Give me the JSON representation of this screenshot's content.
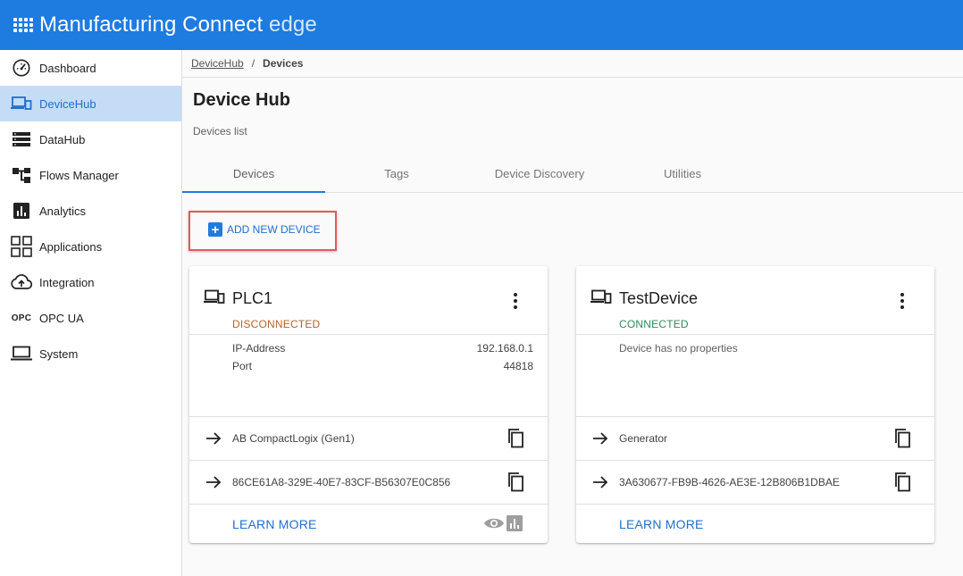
{
  "app": {
    "title_main": "Manufacturing Connect",
    "title_suffix": " edge",
    "menu_icon": "apps-grid-icon",
    "header_color": "#1e7be0"
  },
  "sidebar": {
    "items": [
      {
        "label": "Dashboard",
        "icon": "dashboard-gauge-icon"
      },
      {
        "label": "DeviceHub",
        "icon": "devices-icon",
        "active": true
      },
      {
        "label": "DataHub",
        "icon": "storage-icon"
      },
      {
        "label": "Flows Manager",
        "icon": "flow-icon"
      },
      {
        "label": "Analytics",
        "icon": "analytics-icon"
      },
      {
        "label": "Applications",
        "icon": "apps-icon"
      },
      {
        "label": "Integration",
        "icon": "cloud-upload-icon"
      },
      {
        "label": "OPC UA",
        "icon": "opc-text-icon",
        "icon_text": "OPC"
      },
      {
        "label": "System",
        "icon": "laptop-icon"
      }
    ]
  },
  "breadcrumb": {
    "parent": "DeviceHub",
    "separator": "/",
    "current": "Devices"
  },
  "page": {
    "title": "Device Hub",
    "subtitle": "Devices list"
  },
  "tabs": [
    {
      "label": "Devices",
      "active": true
    },
    {
      "label": "Tags"
    },
    {
      "label": "Device Discovery"
    },
    {
      "label": "Utilities"
    }
  ],
  "add_button": {
    "label": "ADD NEW DEVICE",
    "icon": "plus-box-icon"
  },
  "devices": [
    {
      "name": "PLC1",
      "status": "DISCONNECTED",
      "properties": [
        {
          "key": "IP-Address",
          "value": "192.168.0.1"
        },
        {
          "key": "Port",
          "value": "44818"
        }
      ],
      "driver": "AB CompactLogix (Gen1)",
      "id": "86CE61A8-329E-40E7-83CF-B56307E0C856",
      "learn_more": "LEARN MORE"
    },
    {
      "name": "TestDevice",
      "status": "CONNECTED",
      "no_properties": "Device has no properties",
      "driver": "Generator",
      "id": "3A630677-FB9B-4626-AE3E-12B806B1DBAE",
      "learn_more": "LEARN MORE"
    }
  ],
  "colors": {
    "accent": "#1e7be0",
    "disconnected": "#b4642a",
    "connected": "#2e8b57",
    "highlight_box": "#e05a5a"
  }
}
